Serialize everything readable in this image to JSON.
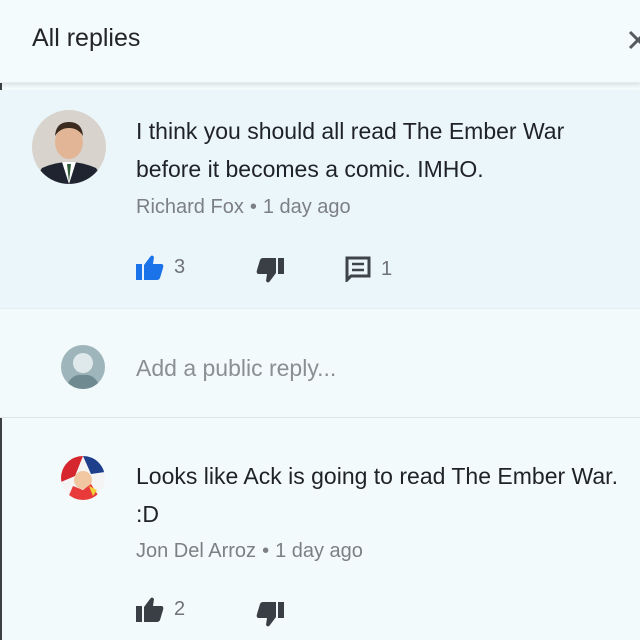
{
  "header": {
    "title": "All replies",
    "close_icon": "close-icon"
  },
  "comments": [
    {
      "text": "I think you should all read The Ember War before it becomes a comic. IMHO.",
      "author": "Richard Fox",
      "separator": "•",
      "time": "1 day ago",
      "likes": "3",
      "replies": "1",
      "colors": {
        "like_icon": "#1a73e8"
      }
    },
    {
      "text": "Looks like Ack is going to read The Ember War.  :D",
      "author": "Jon Del Arroz",
      "separator": "•",
      "time": "1 day ago",
      "likes": "2"
    }
  ],
  "reply_box": {
    "placeholder": "Add a public reply..."
  },
  "icons": [
    "thumbs-up-icon",
    "thumbs-down-icon",
    "reply-icon",
    "close-icon"
  ]
}
